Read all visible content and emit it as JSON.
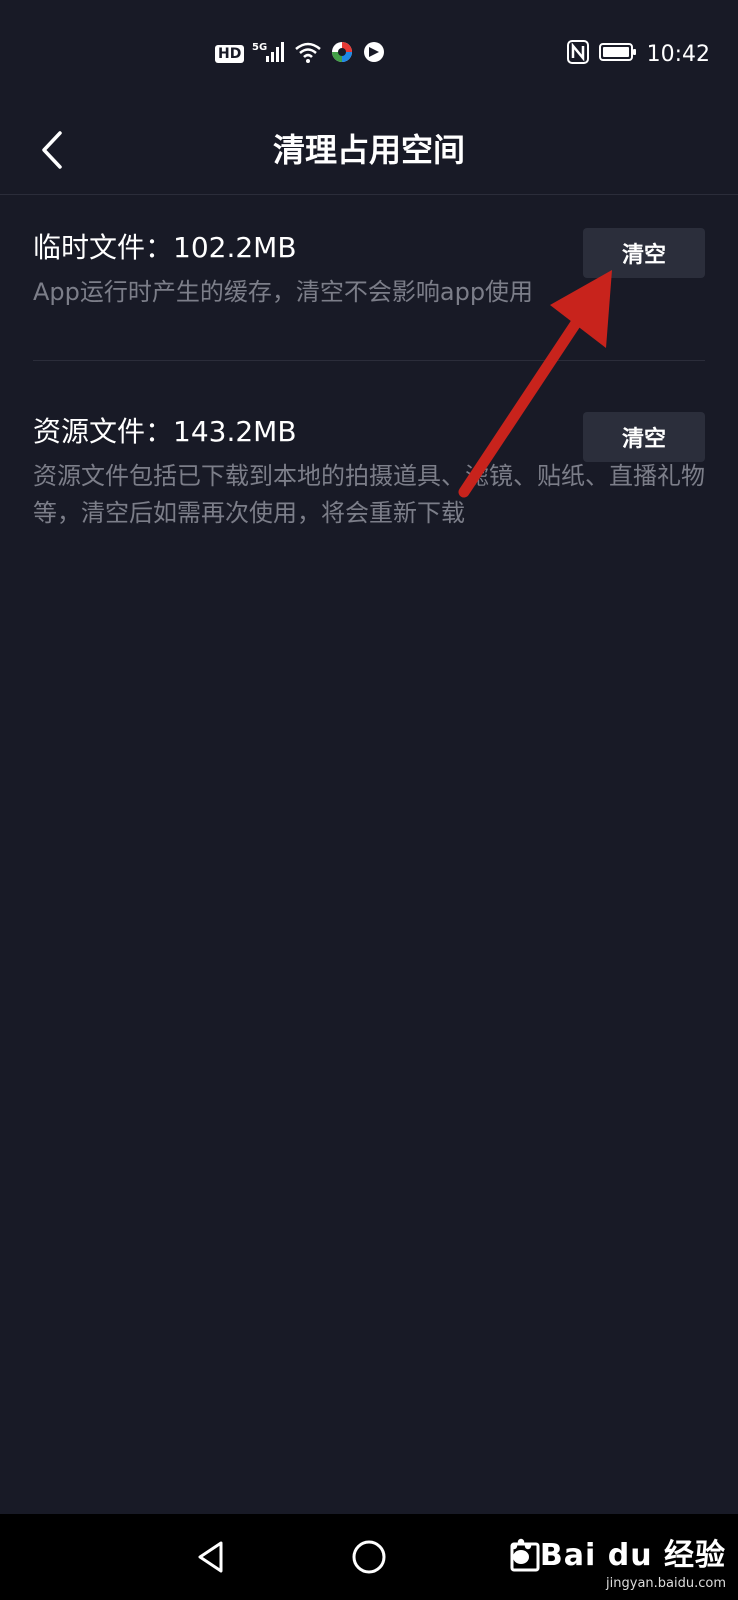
{
  "status_bar": {
    "hd": "HD",
    "network": "5G",
    "time": "10:42",
    "icons": [
      "hd-icon",
      "signal-icon",
      "wifi-icon",
      "app-notification-icon",
      "app-notification-icon",
      "nfc-icon",
      "battery-icon"
    ]
  },
  "header": {
    "title": "清理占用空间",
    "back_icon": "chevron-left-icon"
  },
  "items": [
    {
      "title": "临时文件：102.2MB",
      "description": "App运行时产生的缓存，清空不会影响app使用",
      "button": "清空"
    },
    {
      "title": "资源文件：143.2MB",
      "description": "资源文件包括已下载到本地的拍摄道具、滤镜、贴纸、直播礼物等，清空后如需再次使用，将会重新下载",
      "button": "清空"
    }
  ],
  "annotation": {
    "color": "#c8231c",
    "icon": "red-arrow-icon"
  },
  "bottom_nav": {
    "icons": [
      "back-triangle-icon",
      "home-circle-icon",
      "recents-square-icon"
    ]
  },
  "watermark": {
    "logo": "Bai du 经验",
    "url": "jingyan.baidu.com"
  },
  "colors": {
    "background": "#181a26",
    "button_bg": "#2b2e3b",
    "description": "#7c7e89",
    "divider": "#2b2d3a"
  }
}
